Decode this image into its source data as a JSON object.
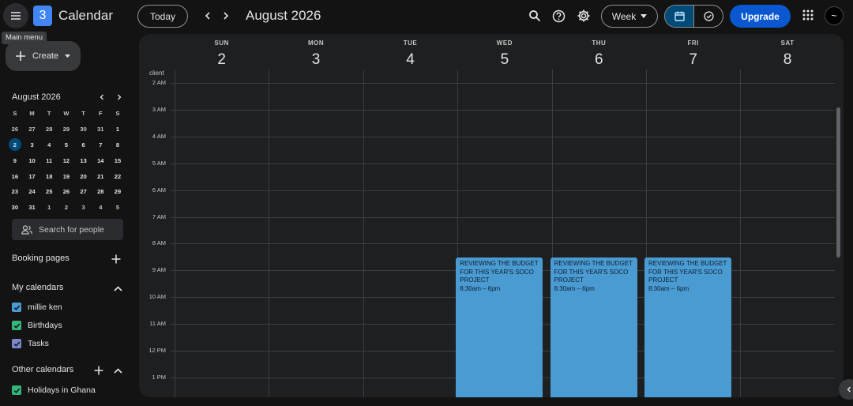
{
  "header": {
    "app_title": "Calendar",
    "logo_text": "3",
    "tooltip": "Main menu",
    "today_label": "Today",
    "date_range": "August 2026",
    "view_label": "Week",
    "upgrade_label": "Upgrade",
    "avatar_text": "~"
  },
  "sidebar": {
    "create_label": "Create",
    "mini_calendar": {
      "title": "August 2026",
      "weekdays": [
        "S",
        "M",
        "T",
        "W",
        "T",
        "F",
        "S"
      ],
      "weeks": [
        [
          "26",
          "27",
          "28",
          "29",
          "30",
          "31",
          "1"
        ],
        [
          "2",
          "3",
          "4",
          "5",
          "6",
          "7",
          "8"
        ],
        [
          "9",
          "10",
          "11",
          "12",
          "13",
          "14",
          "15"
        ],
        [
          "16",
          "17",
          "18",
          "19",
          "20",
          "21",
          "22"
        ],
        [
          "23",
          "24",
          "25",
          "26",
          "27",
          "28",
          "29"
        ],
        [
          "30",
          "31",
          "1",
          "2",
          "3",
          "4",
          "5"
        ]
      ],
      "selected": "2"
    },
    "people_search_placeholder": "Search for people",
    "booking_pages_label": "Booking pages",
    "my_calendars_label": "My calendars",
    "my_calendars": [
      {
        "name": "millie ken",
        "color": "#4b9bd3"
      },
      {
        "name": "Birthdays",
        "color": "#33b679"
      },
      {
        "name": "Tasks",
        "color": "#7986cb"
      }
    ],
    "other_calendars_label": "Other calendars",
    "other_calendars": [
      {
        "name": "Holidays in Ghana",
        "color": "#33b679"
      }
    ]
  },
  "week": {
    "timezone_label": "client",
    "days": [
      {
        "name": "SUN",
        "num": "2"
      },
      {
        "name": "MON",
        "num": "3"
      },
      {
        "name": "TUE",
        "num": "4"
      },
      {
        "name": "WED",
        "num": "5"
      },
      {
        "name": "THU",
        "num": "6"
      },
      {
        "name": "FRI",
        "num": "7"
      },
      {
        "name": "SAT",
        "num": "8"
      }
    ],
    "hours": [
      "2 AM",
      "3 AM",
      "4 AM",
      "5 AM",
      "6 AM",
      "7 AM",
      "8 AM",
      "9 AM",
      "10 AM",
      "11 AM",
      "12 PM",
      "1 PM"
    ],
    "events": [
      {
        "day": 3,
        "title": "REVIEWING THE BUDGET FOR THIS YEAR'S SOCO PROJECT",
        "time": "8:30am – 6pm",
        "color": "#4b9bd3"
      },
      {
        "day": 4,
        "title": "REVIEWING THE BUDGET FOR THIS YEAR'S SOCO PROJECT",
        "time": "8:30am – 6pm",
        "color": "#4b9bd3"
      },
      {
        "day": 5,
        "title": "REVIEWING THE BUDGET FOR THIS YEAR'S SOCO PROJECT",
        "time": "8:30am – 6pm",
        "color": "#4b9bd3"
      }
    ]
  },
  "colors": {
    "accent": "#0b57d0",
    "selected_toggle": "#004a77",
    "event": "#4b9bd3",
    "background": "#131314",
    "panel": "#1e1f20"
  }
}
